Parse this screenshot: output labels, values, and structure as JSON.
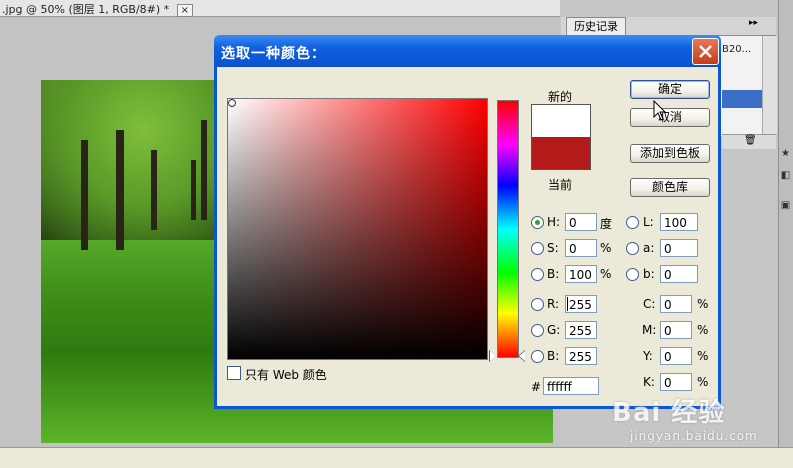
{
  "document": {
    "tab_title": ".jpg @ 50% (图层 1, RGB/8#) *",
    "tab_close": "×"
  },
  "history_panel": {
    "tab_label": "历史记录",
    "collapse_glyph": "▸▸",
    "item_text": "B20..."
  },
  "dialog": {
    "title": "选取一种颜色：",
    "new_label": "新的",
    "current_label": "当前",
    "new_color": "#ffffff",
    "current_color": "#b41a1a",
    "ok_label": "确定",
    "cancel_label": "取消",
    "add_to_swatches_label": "添加到色板",
    "color_libraries_label": "颜色库",
    "web_only_label": "只有 Web 颜色",
    "hex_label": "#",
    "hex_value": "ffffff",
    "hsb": {
      "h_label": "H:",
      "h_value": "0",
      "h_unit": "度",
      "s_label": "S:",
      "s_value": "0",
      "s_unit": "%",
      "b_label": "B:",
      "b_value": "100",
      "b_unit": "%"
    },
    "rgb": {
      "r_label": "R:",
      "r_value": "255",
      "g_label": "G:",
      "g_value": "255",
      "b_label": "B:",
      "b_value": "255"
    },
    "lab": {
      "l_label": "L:",
      "l_value": "100",
      "a_label": "a:",
      "a_value": "0",
      "b_label": "b:",
      "b_value": "0"
    },
    "cmyk": {
      "c_label": "C:",
      "c_value": "0",
      "c_unit": "%",
      "m_label": "M:",
      "m_value": "0",
      "m_unit": "%",
      "y_label": "Y:",
      "y_value": "0",
      "y_unit": "%",
      "k_label": "K:",
      "k_value": "0",
      "k_unit": "%"
    },
    "selected_mode": "H",
    "hue_selected_degrees": 0
  },
  "watermark": {
    "brand": "Bai 经验",
    "url": "jingyan.baidu.com"
  },
  "icons": [
    "close-icon",
    "mouse-pointer-icon",
    "trash-icon",
    "star-icon"
  ]
}
